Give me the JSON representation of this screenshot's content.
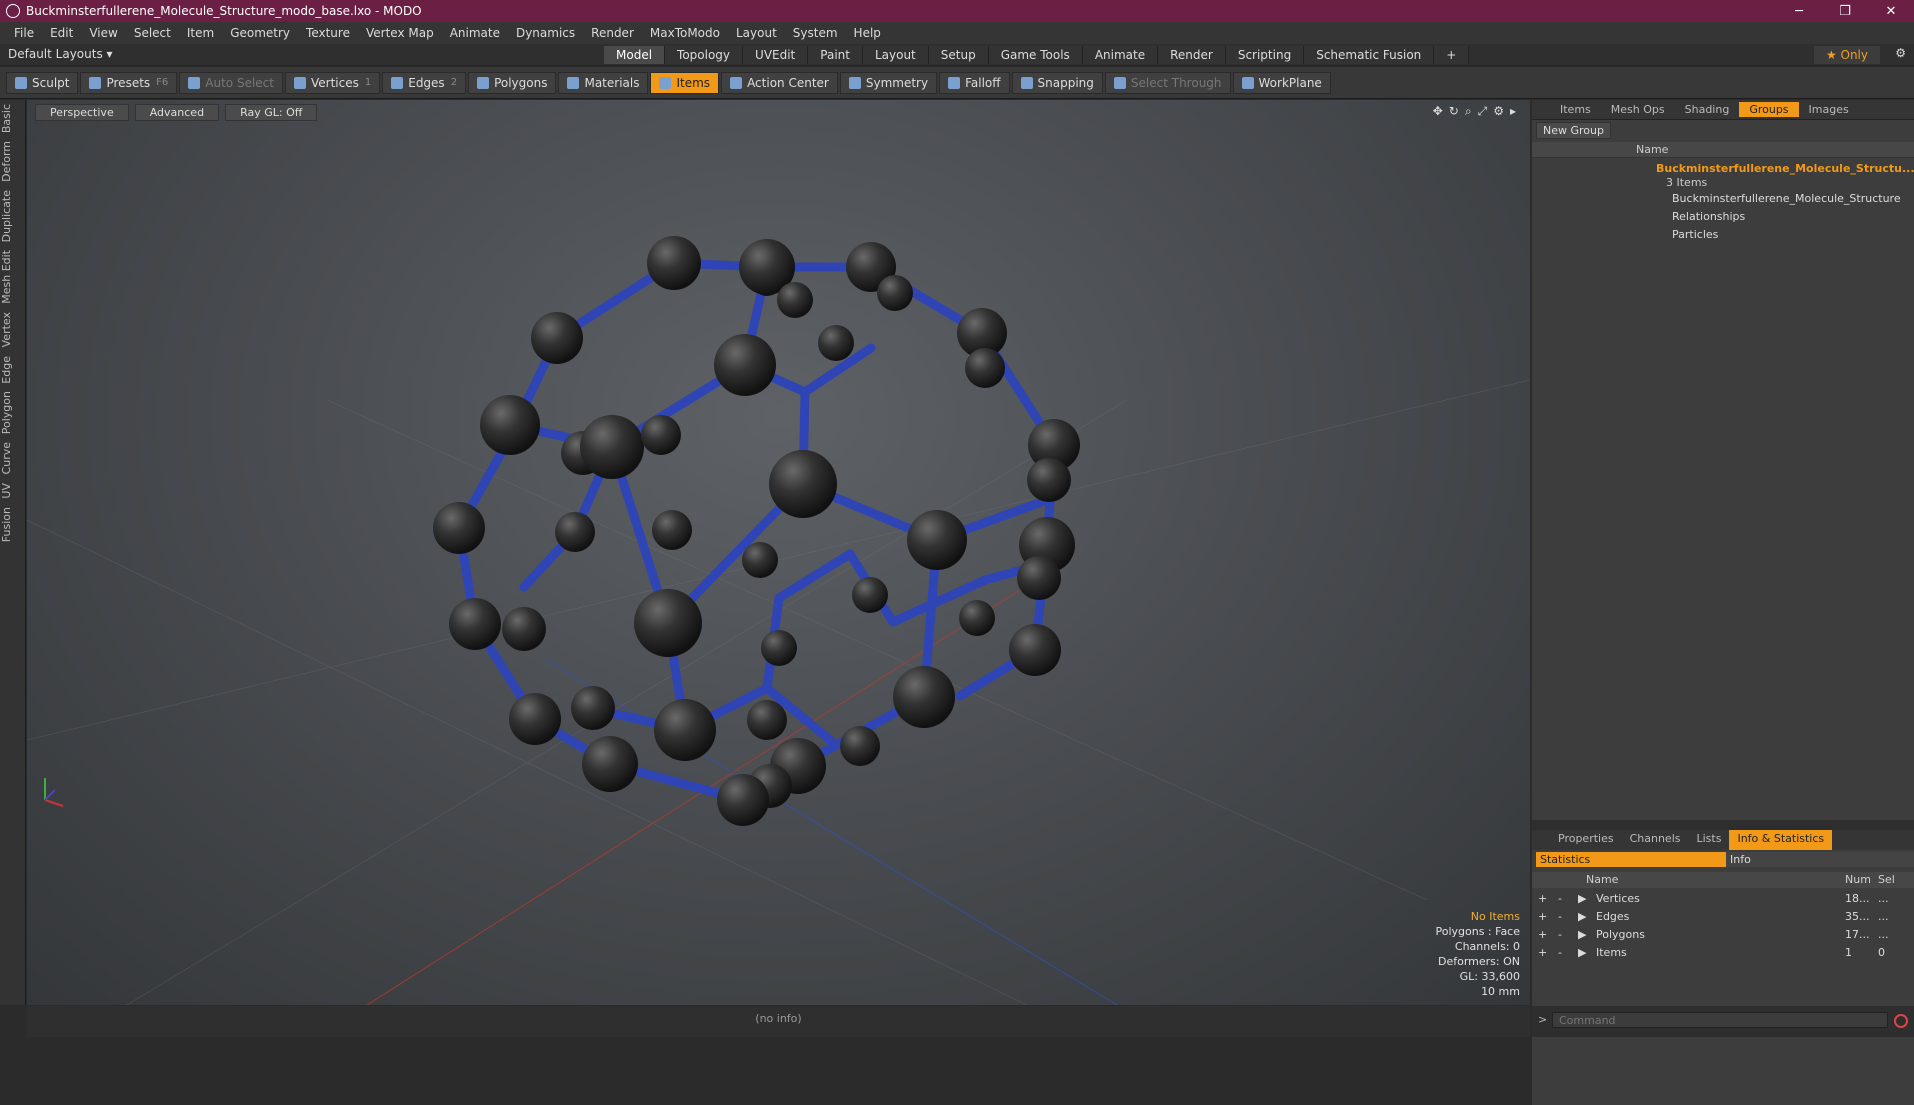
{
  "window": {
    "title": "Buckminsterfullerene_Molecule_Structure_modo_base.lxo - MODO",
    "minimize": "─",
    "maximize": "❐",
    "close": "✕"
  },
  "menu": [
    "File",
    "Edit",
    "View",
    "Select",
    "Item",
    "Geometry",
    "Texture",
    "Vertex Map",
    "Animate",
    "Dynamics",
    "Render",
    "MaxToModo",
    "Layout",
    "System",
    "Help"
  ],
  "layout": {
    "label": "Default Layouts ▾",
    "tabs": [
      "Model",
      "Topology",
      "UVEdit",
      "Paint",
      "Layout",
      "Setup",
      "Game Tools",
      "Animate",
      "Render",
      "Scripting",
      "Schematic Fusion"
    ],
    "add": "+",
    "only": "★ Only"
  },
  "toolbar": {
    "sculpt": "Sculpt",
    "presets": "Presets",
    "presets_key": "F6",
    "autoselect": "Auto Select",
    "vertices": "Vertices",
    "vertices_n": "1",
    "edges": "Edges",
    "edges_n": "2",
    "polygons": "Polygons",
    "materials": "Materials",
    "items": "Items",
    "action_center": "Action Center",
    "symmetry": "Symmetry",
    "falloff": "Falloff",
    "snapping": "Snapping",
    "select_through": "Select Through",
    "workplane": "WorkPlane"
  },
  "left_tabs": [
    "Basic",
    "Deform",
    "Duplicate",
    "Mesh Edit",
    "Vertex",
    "Edge",
    "Polygon",
    "Curve",
    "UV",
    "Fusion"
  ],
  "viewport": {
    "view": "Perspective",
    "shading": "Advanced",
    "raygl": "Ray GL: Off",
    "info": {
      "items": "No Items",
      "polygons": "Polygons : Face",
      "channels": "Channels: 0",
      "deformers": "Deformers: ON",
      "gl": "GL: 33,600",
      "scale": "10 mm"
    }
  },
  "status": "(no info)",
  "groups_panel": {
    "tabs": [
      "Items",
      "Mesh Ops",
      "Shading",
      "Groups",
      "Images"
    ],
    "active": "Groups",
    "new_group": "New Group",
    "col_name": "Name",
    "root": "Buckminsterfullerene_Molecule_Structu...",
    "root_count": "3 Items",
    "children": [
      "Buckminsterfullerene_Molecule_Structure",
      "Relationships",
      "Particles"
    ]
  },
  "stats_panel": {
    "tabs": [
      "Properties",
      "Channels",
      "Lists",
      "Info & Statistics"
    ],
    "active": "Info & Statistics",
    "sub": [
      "Statistics",
      "Info"
    ],
    "cols": [
      "Name",
      "Num",
      "Sel"
    ],
    "rows": [
      {
        "name": "Vertices",
        "num": "18...",
        "sel": "..."
      },
      {
        "name": "Edges",
        "num": "35...",
        "sel": "..."
      },
      {
        "name": "Polygons",
        "num": "17...",
        "sel": "..."
      },
      {
        "name": "Items",
        "num": "1",
        "sel": "0"
      }
    ]
  },
  "command": {
    "placeholder": "Command"
  }
}
